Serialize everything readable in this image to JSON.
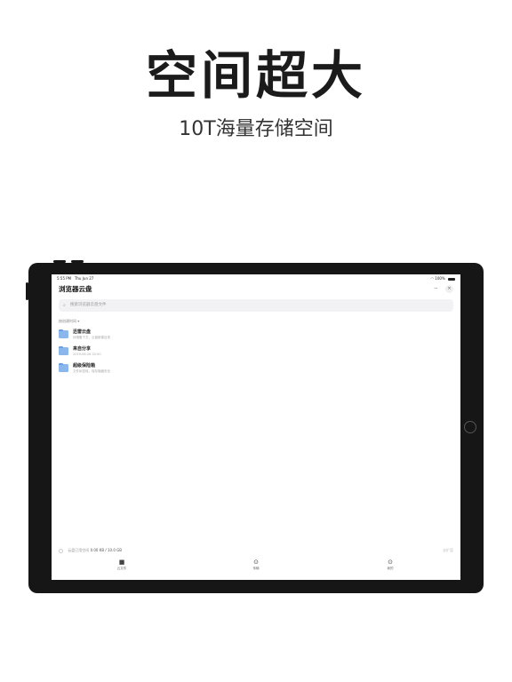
{
  "promo": {
    "headline": "空间超大",
    "subline": "10T海量存储空间"
  },
  "status_bar": {
    "time": "5:55 PM",
    "date": "Thu Jun 27",
    "battery": "100%"
  },
  "app": {
    "title": "浏览器云盘",
    "more": "···",
    "close": "×"
  },
  "search": {
    "placeholder": "搜索浏览器云盘文件"
  },
  "sort_label": "按创建时间 ▾",
  "folders": [
    {
      "name": "迅雷云盘",
      "desc": "待储备下方，云盘新建目录"
    },
    {
      "name": "来自分享",
      "desc": "2019-06-26 20:50"
    },
    {
      "name": "超级保险箱",
      "desc": "文件私密保，保存隐藏安全"
    }
  ],
  "storage": {
    "label": "云盘已用空间",
    "value": "0.00 KB / 10.0 GB",
    "expand": "去扩容"
  },
  "tabs": [
    {
      "label": "云文件",
      "icon": "folder-icon"
    },
    {
      "label": "传输",
      "icon": "transfer-icon"
    },
    {
      "label": "我的",
      "icon": "profile-icon"
    }
  ]
}
